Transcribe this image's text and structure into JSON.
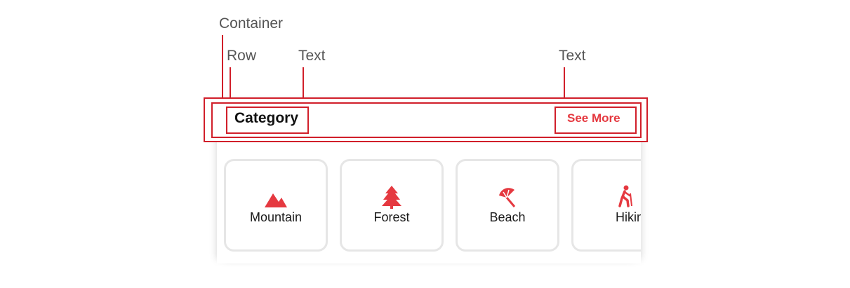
{
  "annotations": {
    "container": "Container",
    "row": "Row",
    "text_left": "Text",
    "text_right": "Text"
  },
  "header": {
    "title": "Category",
    "see_more": "See More"
  },
  "categories": [
    {
      "label": "Mountain",
      "icon": "mountain-icon"
    },
    {
      "label": "Forest",
      "icon": "tree-icon"
    },
    {
      "label": "Beach",
      "icon": "beach-umbrella-icon"
    },
    {
      "label": "Hiking",
      "icon": "hiking-icon"
    }
  ],
  "colors": {
    "accent": "#e53940",
    "annotation": "#d11f2a",
    "card_border": "#e6e6e6"
  }
}
